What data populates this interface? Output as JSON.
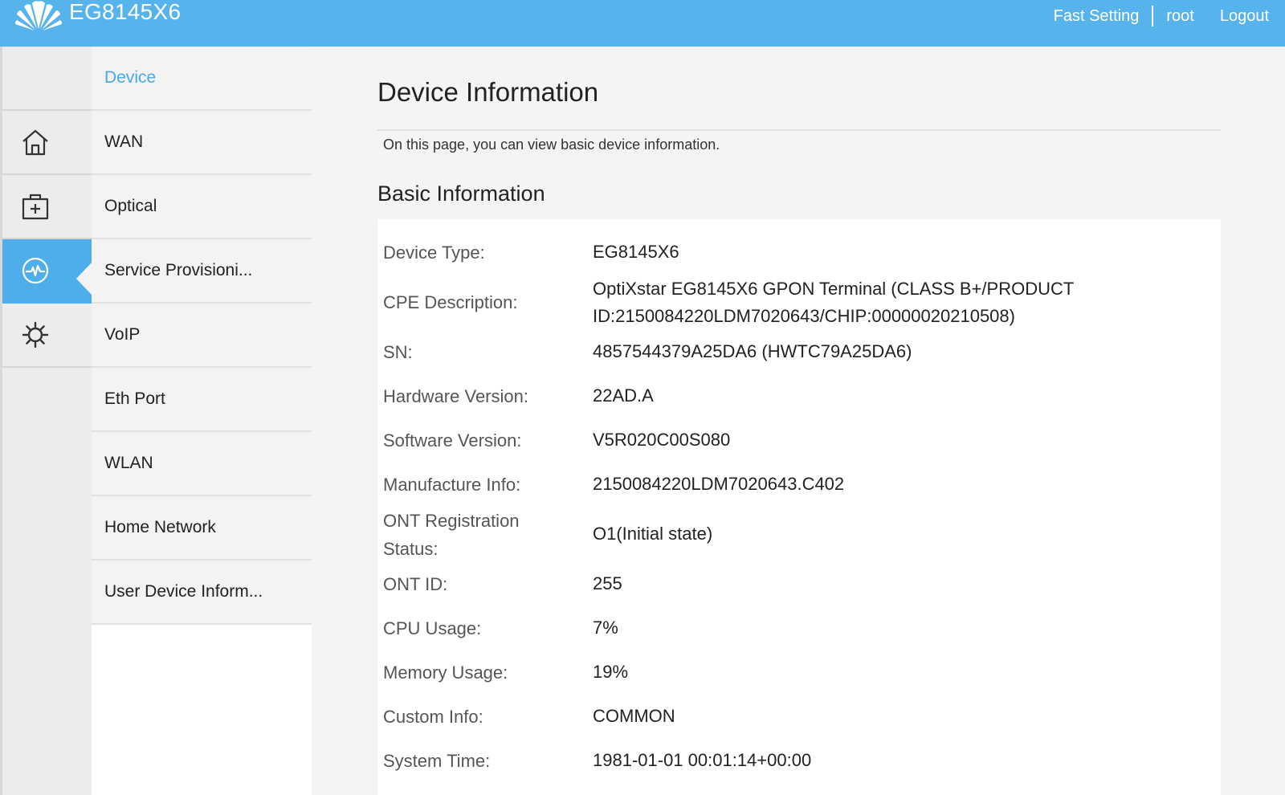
{
  "header": {
    "product_name": "EG8145X6",
    "links": {
      "fast_setting": "Fast Setting",
      "user": "root",
      "logout": "Logout"
    },
    "colors": {
      "bar": "#57b3ec"
    }
  },
  "icon_nav": {
    "items": [
      {
        "name": "home-icon",
        "active": false
      },
      {
        "name": "medical-kit-icon",
        "active": false
      },
      {
        "name": "pulse-icon",
        "active": true
      },
      {
        "name": "gear-icon",
        "active": false
      }
    ]
  },
  "sub_menu": {
    "items": [
      {
        "label": "Device",
        "selected": true
      },
      {
        "label": "WAN"
      },
      {
        "label": "Optical"
      },
      {
        "label": "Service Provisioni..."
      },
      {
        "label": "VoIP"
      },
      {
        "label": "Eth Port"
      },
      {
        "label": "WLAN"
      },
      {
        "label": "Home Network"
      },
      {
        "label": "User Device Inform..."
      }
    ]
  },
  "main": {
    "title": "Device Information",
    "description": "On this page, you can view basic device information.",
    "section_title": "Basic Information",
    "rows": [
      {
        "label": "Device Type:",
        "value": "EG8145X6"
      },
      {
        "label": "CPE Description:",
        "value": "OptiXstar EG8145X6 GPON Terminal (CLASS B+/PRODUCT",
        "value2": "ID:2150084220LDM7020643/CHIP:00000020210508)"
      },
      {
        "label": "SN:",
        "value": "4857544379A25DA6 (HWTC79A25DA6)"
      },
      {
        "label": "Hardware Version:",
        "value": "22AD.A"
      },
      {
        "label": "Software Version:",
        "value": "V5R020C00S080"
      },
      {
        "label": "Manufacture Info:",
        "value": "2150084220LDM7020643.C402"
      },
      {
        "label": "ONT Registration",
        "label2": "Status:",
        "value": "O1(Initial state)"
      },
      {
        "label": "ONT ID:",
        "value": "255"
      },
      {
        "label": "CPU Usage:",
        "value": "7%"
      },
      {
        "label": "Memory Usage:",
        "value": "19%"
      },
      {
        "label": "Custom Info:",
        "value": "COMMON"
      },
      {
        "label": "System Time:",
        "value": "1981-01-01 00:01:14+00:00"
      }
    ]
  }
}
